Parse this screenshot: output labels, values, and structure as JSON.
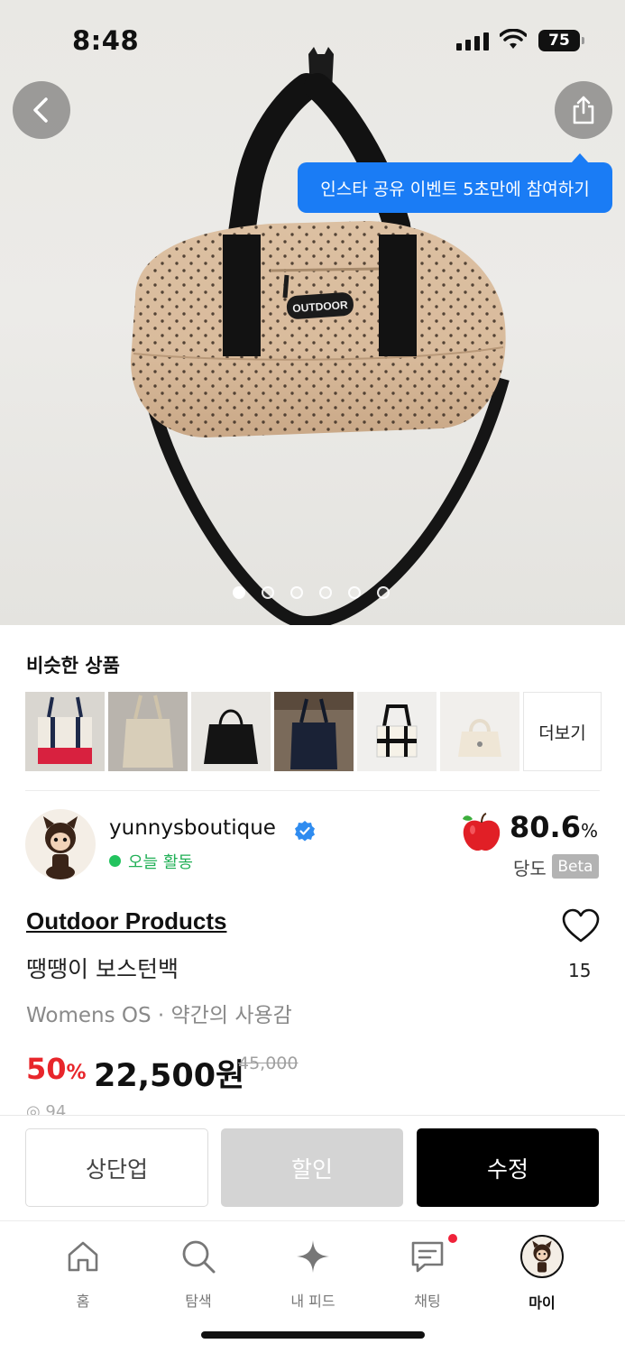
{
  "status_bar": {
    "time": "8:48",
    "battery": "75"
  },
  "hero": {
    "tooltip": "인스타 공유 이벤트 5초만에 참여하기",
    "logo_text": "OUTDOOR",
    "photo_count": 6,
    "active_photo": 1
  },
  "similar": {
    "title": "비슷한 상품",
    "more_label": "더보기",
    "thumbnails": [
      "tote-red-bottom",
      "canvas-tote-beige",
      "black-tote",
      "navy-bag",
      "white-tote-black-straps",
      "cream-mini-bag"
    ]
  },
  "seller": {
    "name": "yunnysboutique",
    "status": "오늘 활동",
    "score": "80.6",
    "score_unit": "%",
    "score_label": "당도",
    "score_badge": "Beta"
  },
  "product": {
    "brand": "Outdoor Products",
    "name": "땡땡이 보스턴백",
    "meta": "Womens OS · 약간의 사용감",
    "likes": "15",
    "discount": "50",
    "discount_unit": "%",
    "price": "22,500원",
    "original_price": "45,000",
    "views": "◎ 94"
  },
  "actions": {
    "bump": "상단업",
    "discount": "할인",
    "edit": "수정"
  },
  "tabs": [
    {
      "label": "홈",
      "icon": "home-icon"
    },
    {
      "label": "탐색",
      "icon": "search-icon"
    },
    {
      "label": "내 피드",
      "icon": "sparkle-icon"
    },
    {
      "label": "채팅",
      "icon": "chat-icon"
    },
    {
      "label": "마이",
      "icon": "profile-avatar"
    }
  ],
  "colors": {
    "accent_blue": "#1a7cf5",
    "discount_red": "#e8262b",
    "active_green": "#22c35e",
    "badge_red": "#f0223a"
  }
}
